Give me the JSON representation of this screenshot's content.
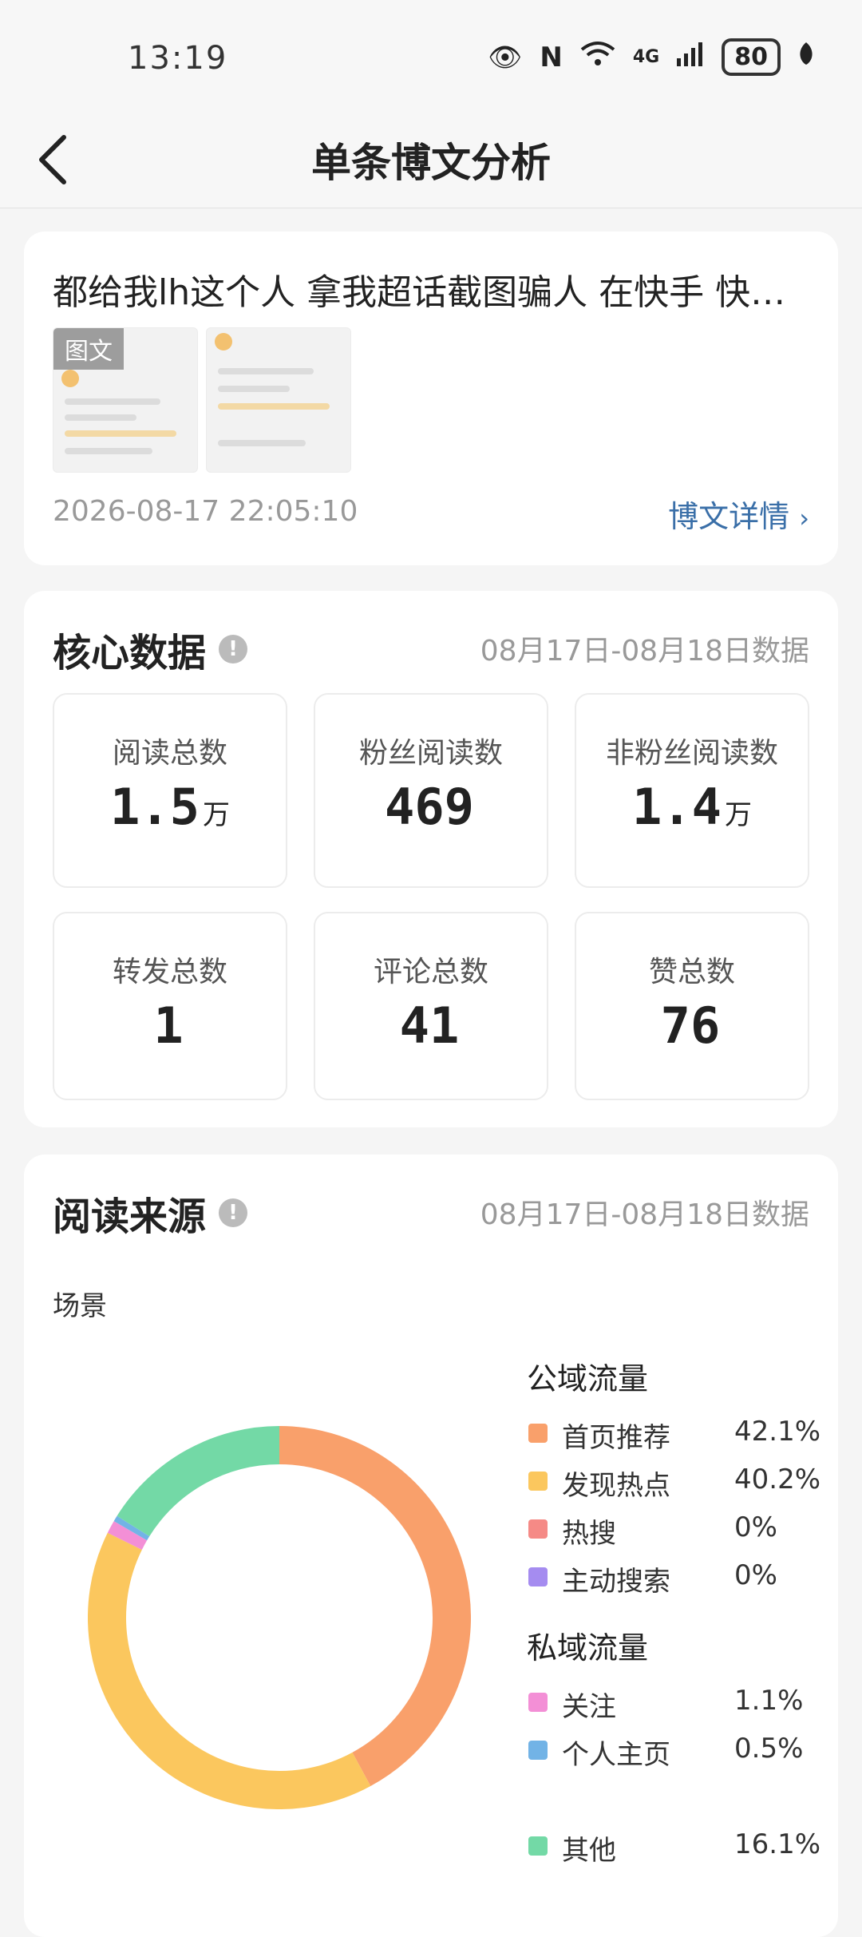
{
  "status": {
    "time": "13:19",
    "battery": "80",
    "network": "4G"
  },
  "nav": {
    "title": "单条博文分析"
  },
  "post": {
    "title": "都给我lh这个人 拿我超话截图骗人 在快手 快…",
    "badge": "图文",
    "date": "2026-08-17 22:05:10",
    "detail_link": "博文详情"
  },
  "core": {
    "title": "核心数据",
    "date_range": "08月17日-08月18日数据",
    "stats": [
      {
        "label": "阅读总数",
        "value": "1.5",
        "unit": "万"
      },
      {
        "label": "粉丝阅读数",
        "value": "469",
        "unit": ""
      },
      {
        "label": "非粉丝阅读数",
        "value": "1.4",
        "unit": "万"
      },
      {
        "label": "转发总数",
        "value": "1",
        "unit": ""
      },
      {
        "label": "评论总数",
        "value": "41",
        "unit": ""
      },
      {
        "label": "赞总数",
        "value": "76",
        "unit": ""
      }
    ]
  },
  "source": {
    "title": "阅读来源",
    "date_range": "08月17日-08月18日数据",
    "scene_label": "场景",
    "public_label": "公域流量",
    "private_label": "私域流量",
    "legend": [
      {
        "name": "首页推荐",
        "pct": "42.1%",
        "color": "#f9a06b"
      },
      {
        "name": "发现热点",
        "pct": "40.2%",
        "color": "#fbc75e"
      },
      {
        "name": "热搜",
        "pct": "0%",
        "color": "#f58a86"
      },
      {
        "name": "主动搜索",
        "pct": "0%",
        "color": "#a58cf0"
      },
      {
        "name": "关注",
        "pct": "1.1%",
        "color": "#f38fd6"
      },
      {
        "name": "个人主页",
        "pct": "0.5%",
        "color": "#72b3e6"
      },
      {
        "name": "其他",
        "pct": "16.1%",
        "color": "#73d9a6"
      }
    ]
  },
  "chart_data": {
    "type": "pie",
    "categories": [
      "首页推荐",
      "发现热点",
      "热搜",
      "主动搜索",
      "关注",
      "个人主页",
      "其他"
    ],
    "values": [
      42.1,
      40.2,
      0,
      0,
      1.1,
      0.5,
      16.1
    ],
    "colors": [
      "#f9a06b",
      "#fbc75e",
      "#f58a86",
      "#a58cf0",
      "#f38fd6",
      "#72b3e6",
      "#73d9a6"
    ],
    "title": "",
    "legend_placement": "right"
  }
}
